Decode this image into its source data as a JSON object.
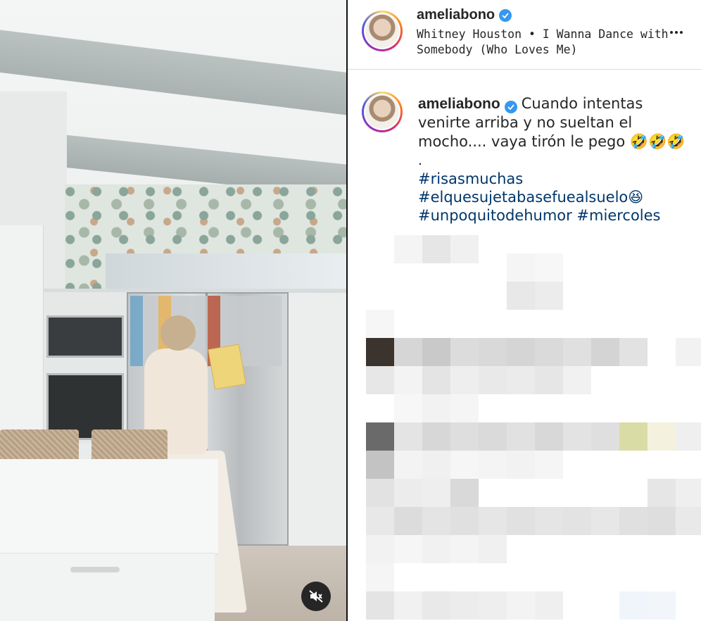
{
  "video": {
    "mute_icon": "speaker-muted-icon",
    "colors": {
      "mute_bg": "#262626"
    }
  },
  "post": {
    "header": {
      "username": "ameliabono",
      "verified": true,
      "music": "Whitney Houston • I Wanna Dance with Somebody (Who Loves Me)",
      "more_icon": "more-options-icon"
    },
    "caption": {
      "username": "ameliabono",
      "verified": true,
      "text": "Cuando intentas venirte arriba y no sueltan el mocho.... vaya tirón le pego 🤣🤣🤣",
      "separator": ".",
      "hashtags": [
        "#risasmuchas",
        "#elquesujetabasefuealsuelo😆",
        "#unpoquitodehumor #miercoles"
      ]
    },
    "comments_obscured": true
  },
  "colors": {
    "verified": "#3897f0",
    "hashtag": "#00376b",
    "text": "#262626",
    "divider": "#dbdbdb"
  }
}
